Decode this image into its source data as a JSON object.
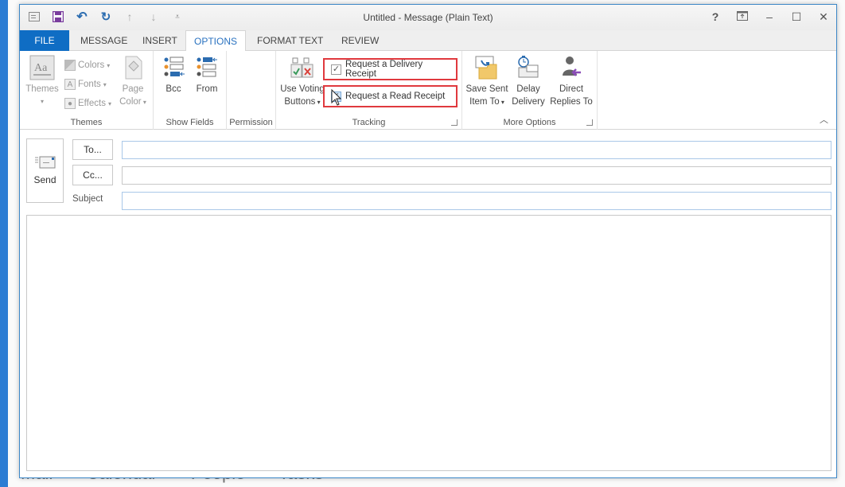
{
  "window": {
    "title": "Untitled - Message (Plain Text)"
  },
  "quick_access": {
    "icons": [
      "message-icon",
      "save-icon",
      "undo-icon",
      "redo-icon",
      "previous-item-icon",
      "next-item-icon",
      "customize-qat-icon"
    ]
  },
  "window_controls": {
    "help": "?",
    "ribbon_display": "ribbon-display-options",
    "minimize": "–",
    "maximize": "☐",
    "close": "✕"
  },
  "tabs": [
    {
      "label": "FILE"
    },
    {
      "label": "MESSAGE"
    },
    {
      "label": "INSERT"
    },
    {
      "label": "OPTIONS",
      "active": true
    },
    {
      "label": "FORMAT TEXT"
    },
    {
      "label": "REVIEW"
    }
  ],
  "ribbon": {
    "themes_group": {
      "label": "Themes",
      "themes": "Themes",
      "colors": "Colors",
      "fonts": "Fonts",
      "effects": "Effects",
      "page_color_1": "Page",
      "page_color_2": "Color"
    },
    "show_fields_group": {
      "label": "Show Fields",
      "bcc": "Bcc",
      "from": "From"
    },
    "permission_group": {
      "label": "Permission"
    },
    "tracking_group": {
      "label": "Tracking",
      "voting_1": "Use Voting",
      "voting_2": "Buttons",
      "delivery_receipt": "Request a Delivery Receipt",
      "delivery_receipt_checked": true,
      "read_receipt": "Request a Read Receipt",
      "read_receipt_checked": true,
      "highlight_color": "#e0393e"
    },
    "more_options_group": {
      "label": "More Options",
      "save_sent_1": "Save Sent",
      "save_sent_2": "Item To",
      "delay_1": "Delay",
      "delay_2": "Delivery",
      "direct_1": "Direct",
      "direct_2": "Replies To"
    }
  },
  "compose": {
    "send": "Send",
    "to_button": "To...",
    "cc_button": "Cc...",
    "subject_label": "Subject",
    "to_value": "",
    "cc_value": "",
    "subject_value": "",
    "body_value": ""
  },
  "background": {
    "nav": [
      "Mail",
      "Calendar",
      "People",
      "Tasks"
    ]
  },
  "colors": {
    "file_tab": "#0f6dc4",
    "active_tab_text": "#2a72c0",
    "window_border": "#3c87c7"
  }
}
